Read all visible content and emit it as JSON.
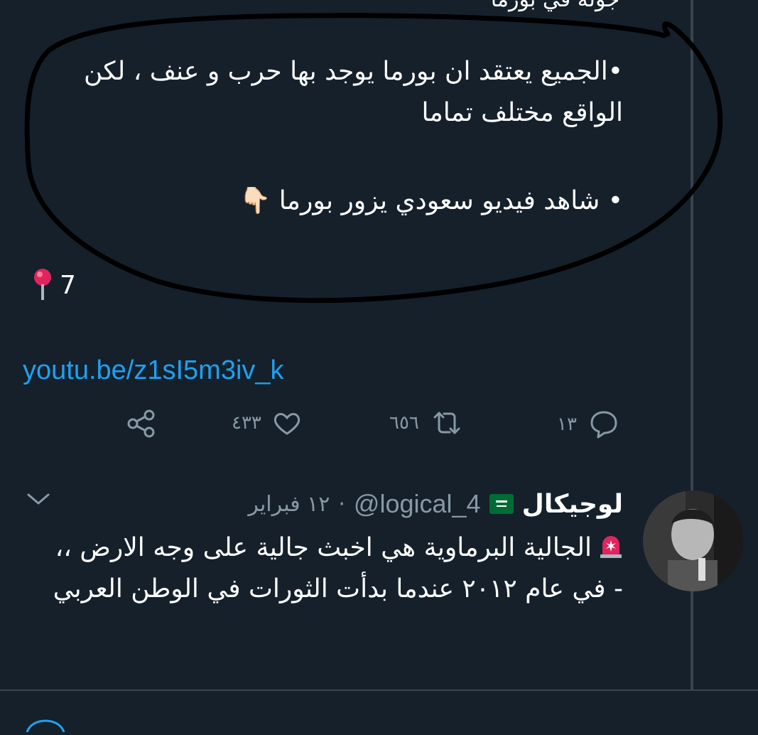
{
  "tweet1": {
    "top_fragment": "جولة في بورما",
    "para1": "•الجميع يعتقد ان بورما يوجد بها حرب و عنف ، لكن الواقع مختلف تماما",
    "para2": "• شاهد فيديو سعودي يزور بورما 👇🏻",
    "pin_count": "7",
    "link": "youtu.be/z1sI5m3iv_k",
    "actions": {
      "replies": "١٣",
      "retweets": "٦٥٦",
      "likes": "٤٣٣"
    }
  },
  "tweet2": {
    "display_name": "لوجيكال",
    "handle": "@logical_4",
    "date": "١٢ فبراير",
    "separator": "·",
    "line1": "الجالية البرماوية هي اخبث جالية على وجه الارض ،،",
    "line2": "- في عام ٢٠١٢ عندما بدأت الثورات في الوطن العربي"
  },
  "icons": [
    "pin-icon",
    "share-icon",
    "heart-icon",
    "retweet-icon",
    "reply-icon",
    "saudi-flag-icon",
    "siren-icon",
    "chevron-down-icon",
    "avatar"
  ],
  "colors": {
    "background": "#15202b",
    "link": "#1da1f2",
    "muted": "#8899a6",
    "divider": "#38444d"
  }
}
